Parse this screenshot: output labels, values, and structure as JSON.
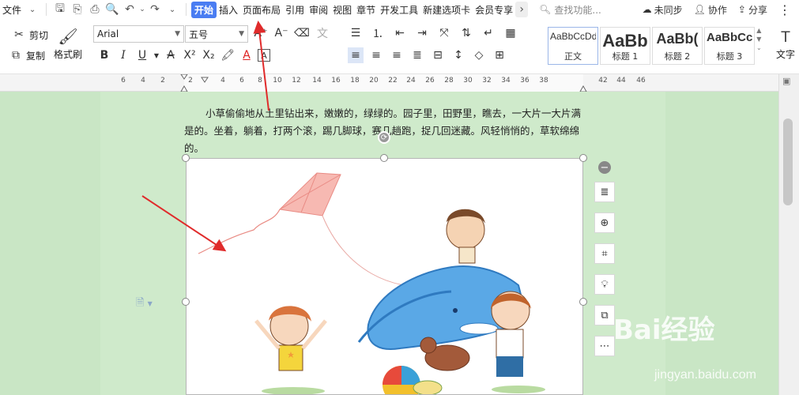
{
  "menubar": {
    "file_label": "文件",
    "tabs": [
      {
        "label": "开始",
        "active": true
      },
      {
        "label": "插入"
      },
      {
        "label": "页面布局"
      },
      {
        "label": "引用"
      },
      {
        "label": "审阅"
      },
      {
        "label": "视图"
      },
      {
        "label": "章节"
      },
      {
        "label": "开发工具"
      },
      {
        "label": "新建选项卡"
      },
      {
        "label": "会员专享"
      }
    ],
    "search_placeholder": "查找功能...",
    "sync_label": "未同步",
    "collab_label": "协作",
    "share_label": "分享"
  },
  "ribbon": {
    "cut_label": "剪切",
    "copy_label": "复制",
    "format_painter_label": "格式刷",
    "font_name": "Arial",
    "font_size": "五号",
    "styles": [
      {
        "sample": "AaBbCcDd",
        "name": "正文"
      },
      {
        "sample": "AaBb",
        "name": "标题 1"
      },
      {
        "sample": "AaBb(",
        "name": "标题 2"
      },
      {
        "sample": "AaBbCcI",
        "name": "标题 3"
      }
    ],
    "text_tool_label": "文字"
  },
  "ruler": {
    "ticks": [
      "6",
      "4",
      "2",
      "2",
      "4",
      "6",
      "8",
      "10",
      "12",
      "14",
      "16",
      "18",
      "20",
      "22",
      "24",
      "26",
      "28",
      "30",
      "32",
      "34",
      "36",
      "38",
      "42",
      "44",
      "46"
    ]
  },
  "document": {
    "paragraph": "小草偷偷地从土里钻出来，嫩嫩的，绿绿的。园子里，田野里，瞧去，一大片一大片满是的。坐着，躺着，打两个滚，踢几脚球，赛几趟跑，捉几回迷藏。风轻悄悄的，草软绵绵的。"
  },
  "watermark": {
    "title": "Bai经验",
    "url": "jingyan.baidu.com"
  },
  "colors": {
    "accent": "#4a7df2",
    "page_bg": "#c9e6c5",
    "annotation_arrow": "#e02b2b"
  }
}
